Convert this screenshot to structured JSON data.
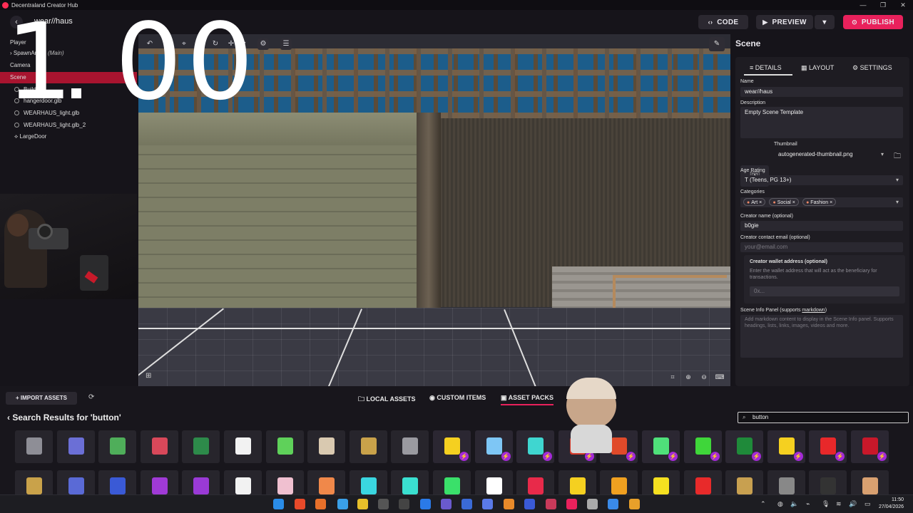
{
  "window": {
    "title": "Decentraland Creator Hub",
    "controls": [
      "—",
      "❐",
      "✕"
    ]
  },
  "header": {
    "scene_name": "wear//haus",
    "code_label": "CODE",
    "preview_label": "PREVIEW",
    "publish_label": "PUBLISH"
  },
  "overlay": {
    "timer": "1 00"
  },
  "tree": {
    "items": [
      {
        "label": "Player",
        "name": "tree-item-player"
      },
      {
        "label": "SpawnArea1",
        "suffix": "(Main)",
        "name": "tree-item-spawnarea"
      },
      {
        "label": "Camera",
        "name": "tree-item-camera"
      },
      {
        "label": "Scene",
        "name": "tree-item-scene"
      },
      {
        "label": "Building",
        "name": "tree-item-building"
      },
      {
        "label": "hangerdoor.glb",
        "name": "tree-item-hangerdoor"
      },
      {
        "label": "WEARHAUS_light.glb",
        "name": "tree-item-light1"
      },
      {
        "label": "WEARHAUS_light.glb_2",
        "name": "tree-item-light2"
      },
      {
        "label": "LargeDoor",
        "name": "tree-item-largedoor"
      }
    ]
  },
  "inspector": {
    "title": "Scene",
    "tabs": [
      "DETAILS",
      "LAYOUT",
      "SETTINGS"
    ],
    "name_label": "Name",
    "name_value": "wear//haus",
    "description_label": "Description",
    "description_value": "Empty Scene Template",
    "thumbnail_label": "Thumbnail",
    "thumbnail_value": "autogenerated-thumbnail.png",
    "age_label": "Age Rating",
    "age_value": "T (Teens, PG 13+)",
    "categories_label": "Categories",
    "categories": [
      "Art",
      "Social",
      "Fashion"
    ],
    "creator_name_label": "Creator name (optional)",
    "creator_name_value": "b0gie",
    "creator_email_label": "Creator contact email (optional)",
    "creator_email_placeholder": "your@email.com",
    "wallet_label": "Creator wallet address (optional)",
    "wallet_help": "Enter the wallet address that will act as the beneficiary for transactions.",
    "wallet_placeholder": "0x...",
    "info_panel_label": "Scene Info Panel (supports ",
    "info_panel_link": "markdown",
    "info_panel_label_end": ")",
    "info_panel_placeholder": "Add markdown content to display in the Scene Info panel. Supports headings, lists, links, images, videos and more."
  },
  "assets": {
    "import_label": "IMPORT ASSETS",
    "tabs": [
      "LOCAL ASSETS",
      "CUSTOM ITEMS",
      "ASSET PACKS"
    ],
    "results_title": "Search Results for 'button'",
    "search_value": "button",
    "row1": [
      {
        "color": "#8e8e96",
        "pack": false
      },
      {
        "color": "#6b6fd6",
        "pack": false
      },
      {
        "color": "#4fae5a",
        "pack": false
      },
      {
        "color": "#d8485a",
        "pack": false
      },
      {
        "color": "#2d8a4a",
        "pack": false
      },
      {
        "color": "#f2f2f2",
        "pack": false
      },
      {
        "color": "#5fd15a",
        "pack": false
      },
      {
        "color": "#d9c9b0",
        "pack": false
      },
      {
        "color": "#c9a24a",
        "pack": false
      },
      {
        "color": "#9a9aa0",
        "pack": false
      },
      {
        "color": "#f5d020",
        "pack": true
      },
      {
        "color": "#7ec6f5",
        "pack": true
      },
      {
        "color": "#3fd6d0",
        "pack": true
      },
      {
        "color": "#d63a2a",
        "pack": true
      },
      {
        "color": "#e04a2a",
        "pack": true
      },
      {
        "color": "#4fe07a",
        "pack": true
      },
      {
        "color": "#3fd63a",
        "pack": true
      },
      {
        "color": "#1f8a3a",
        "pack": true
      },
      {
        "color": "#f5d020",
        "pack": true
      },
      {
        "color": "#e8282a",
        "pack": true
      },
      {
        "color": "#c8182a",
        "pack": true
      }
    ],
    "row2": [
      {
        "color": "#c9a24a"
      },
      {
        "color": "#5a6ad6"
      },
      {
        "color": "#3a5ad6"
      },
      {
        "color": "#a03ad6"
      },
      {
        "color": "#9a3ad6"
      },
      {
        "color": "#f2f2f2"
      },
      {
        "color": "#f0c0d0"
      },
      {
        "color": "#f0884a"
      },
      {
        "color": "#3ad6e0"
      },
      {
        "color": "#3ae0d0"
      },
      {
        "color": "#3ae06a"
      },
      {
        "color": "#ffffff"
      },
      {
        "color": "#e82a4a"
      },
      {
        "color": "#f5d020"
      },
      {
        "color": "#f0a020"
      },
      {
        "color": "#f5e020"
      },
      {
        "color": "#e82a2a"
      },
      {
        "color": "#c8a050"
      },
      {
        "color": "#888888"
      },
      {
        "color": "#333333"
      },
      {
        "color": "#d8a070"
      }
    ]
  },
  "taskbar": {
    "time": "11:50",
    "date": "27/04/2026"
  }
}
